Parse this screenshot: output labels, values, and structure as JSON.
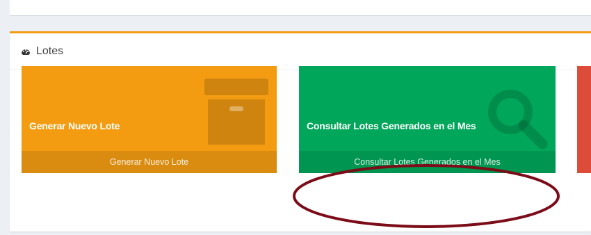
{
  "panel": {
    "title": "Lotes",
    "icon": "dashboard-icon",
    "border_color": "#f39c12"
  },
  "tiles": [
    {
      "title": "Generar Nuevo Lote",
      "footer_link": "Generar Nuevo Lote",
      "color": "#f39c12",
      "icon": "archive-box-icon"
    },
    {
      "title": "Consultar Lotes Generados en el Mes",
      "footer_link": "Consultar Lotes Generados en el Mes",
      "color": "#00a65a",
      "icon": "search-icon"
    },
    {
      "color": "#dd4b39"
    }
  ],
  "annotation": {
    "shape": "ellipse",
    "color": "#7b0c18"
  }
}
